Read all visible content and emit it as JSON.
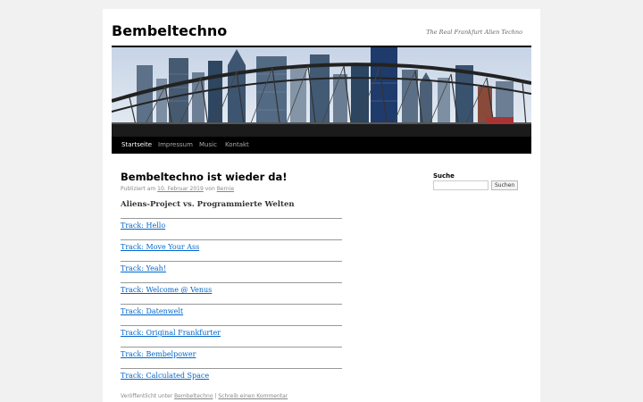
{
  "site": {
    "title": "Bembeltechno",
    "description": "The Real Frankfurt Alien Techno"
  },
  "nav": {
    "items": [
      {
        "label": "Startseite",
        "active": true
      },
      {
        "label": "Impressum",
        "active": false
      },
      {
        "label": "Music",
        "active": false
      },
      {
        "label": "Kontakt",
        "active": false
      }
    ]
  },
  "post": {
    "title": "Bembeltechno ist wieder da!",
    "meta_prefix": "Publiziert am",
    "date": "10. Februar 2019",
    "meta_by": "von",
    "author": "Bernie",
    "subtitle": "Aliens-Project vs. Programmierte Welten",
    "tracks": [
      "Track: Hello",
      "Track: Move Your Ass",
      "Track: Yeah!",
      "Track: Welcome @ Venus",
      "Track: Datenwelt",
      "Track: Original Frankfurter",
      "Track: Bembelpower",
      "Track: Calculated Space"
    ],
    "footer_prefix": "Veröffentlicht unter",
    "category": "Bembeltechno",
    "separator": "|",
    "comment_link": "Schreib einen Kommentar"
  },
  "sidebar": {
    "search_label": "Suche",
    "search_value": "",
    "search_button": "Suchen"
  },
  "colors": {
    "link": "#0066cc",
    "nav_bg": "#000000",
    "page_bg": "#f1f1f1"
  }
}
